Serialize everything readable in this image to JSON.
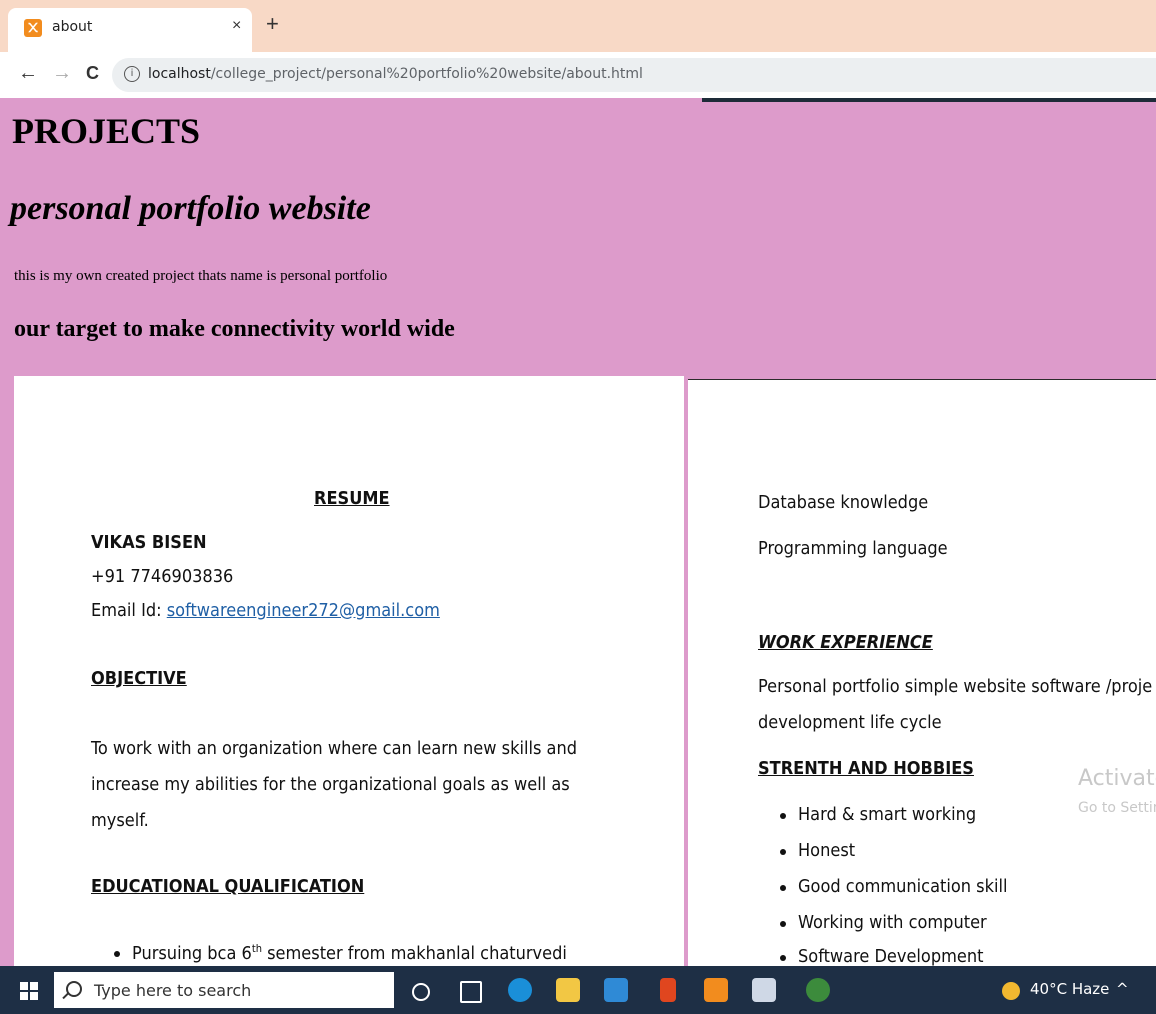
{
  "browser": {
    "tab_title": "about",
    "tab_close": "×",
    "new_tab": "+",
    "back": "←",
    "forward": "→",
    "reload": "C",
    "url_host": "localhost",
    "url_path": "/college_project/personal%20portfolio%20website/about.html"
  },
  "page": {
    "heading": "PROJECTS",
    "subheading": "personal portfolio website",
    "description": "this is my own created project thats name is personal portfolio",
    "target": "our target to make connectivity world wide",
    "background_color": "#dd9bcb"
  },
  "resume_left": {
    "title": "RESUME",
    "name": "VIKAS BISEN",
    "phone": "+91 7746903836",
    "email_label": "Email Id: ",
    "email": "softwareengineer272@gmail.com",
    "objective_title": "OBJECTIVE",
    "objective_lines": [
      "To work with an organization where can learn new skills and",
      "increase my abilities for the organizational goals as well as",
      "myself."
    ],
    "education_title": "EDUCATIONAL QUALIFICATION",
    "education_item_pre": "Pursuing bca 6",
    "education_item_sup": "th",
    "education_item_post": " semester from makhanlal chaturvedi"
  },
  "resume_right": {
    "skills": [
      "Database knowledge",
      "Programming language"
    ],
    "work_title": "WORK EXPERIENCE",
    "work_lines": [
      "Personal portfolio simple website software /proje",
      "development life cycle"
    ],
    "strength_title": "STRENTH AND HOBBIES",
    "strengths": [
      "Hard & smart working",
      "Honest",
      "Good communication skill",
      "Working with computer",
      "Software Development"
    ]
  },
  "watermark": {
    "line1": "Activate ",
    "line2": "Go to Settin"
  },
  "taskbar": {
    "search_placeholder": "Type here to search",
    "weather": "40°C  Haze",
    "tray_chevron": "^"
  }
}
